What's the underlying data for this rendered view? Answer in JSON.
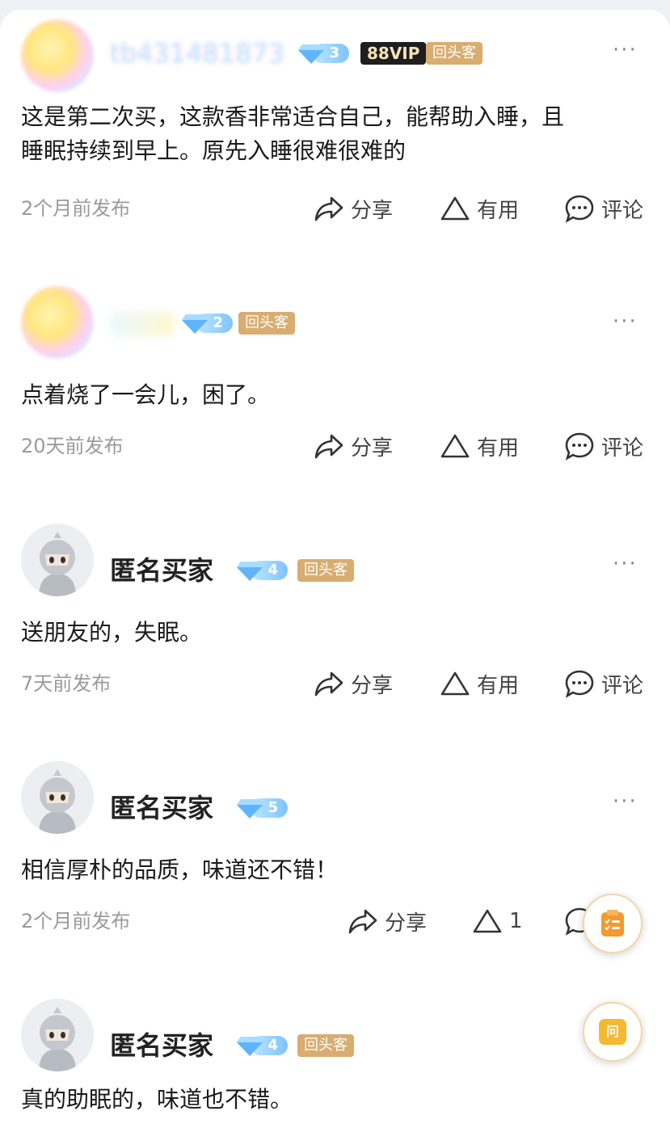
{
  "reviews": [
    {
      "username": "tb431481873",
      "level": "3",
      "vip": "88VIP",
      "repeat_tag": "回头客",
      "text_line1": "这是第二次买，这款香非常适合自己，能帮助入睡，且",
      "text_line2": "睡眠持续到早上。原先入睡很难很难的",
      "time": "2个月前发布",
      "share": "分享",
      "useful": "有用",
      "comment": "评论"
    },
    {
      "username": "",
      "level": "2",
      "repeat_tag": "回头客",
      "text_line1": "点着烧了一会儿，困了。",
      "time": "20天前发布",
      "share": "分享",
      "useful": "有用",
      "comment": "评论"
    },
    {
      "username": "匿名买家",
      "level": "4",
      "repeat_tag": "回头客",
      "text_line1": "送朋友的，失眠。",
      "time": "7天前发布",
      "share": "分享",
      "useful": "有用",
      "comment": "评论"
    },
    {
      "username": "匿名买家",
      "level": "5",
      "text_line1": "相信厚朴的品质，味道还不错！",
      "time": "2个月前发布",
      "share": "分享",
      "useful": "1"
    },
    {
      "username": "匿名买家",
      "level": "4",
      "repeat_tag": "回头客",
      "text_line1": "真的助眠的，味道也不错。"
    }
  ],
  "more_label": "···",
  "float_ask_label": "问",
  "icons": {
    "share": "share-icon",
    "useful": "triangle-up-icon",
    "comment": "comment-bubble-icon",
    "more": "more-dots-icon",
    "cart": "shopping-list-icon",
    "ask": "ask-icon"
  },
  "colors": {
    "repeat_tag": "#d8ad6f",
    "vip_bg": "#1e1e1e",
    "diamond": "#7dc3ff",
    "float_accent": "#f29a2e"
  }
}
